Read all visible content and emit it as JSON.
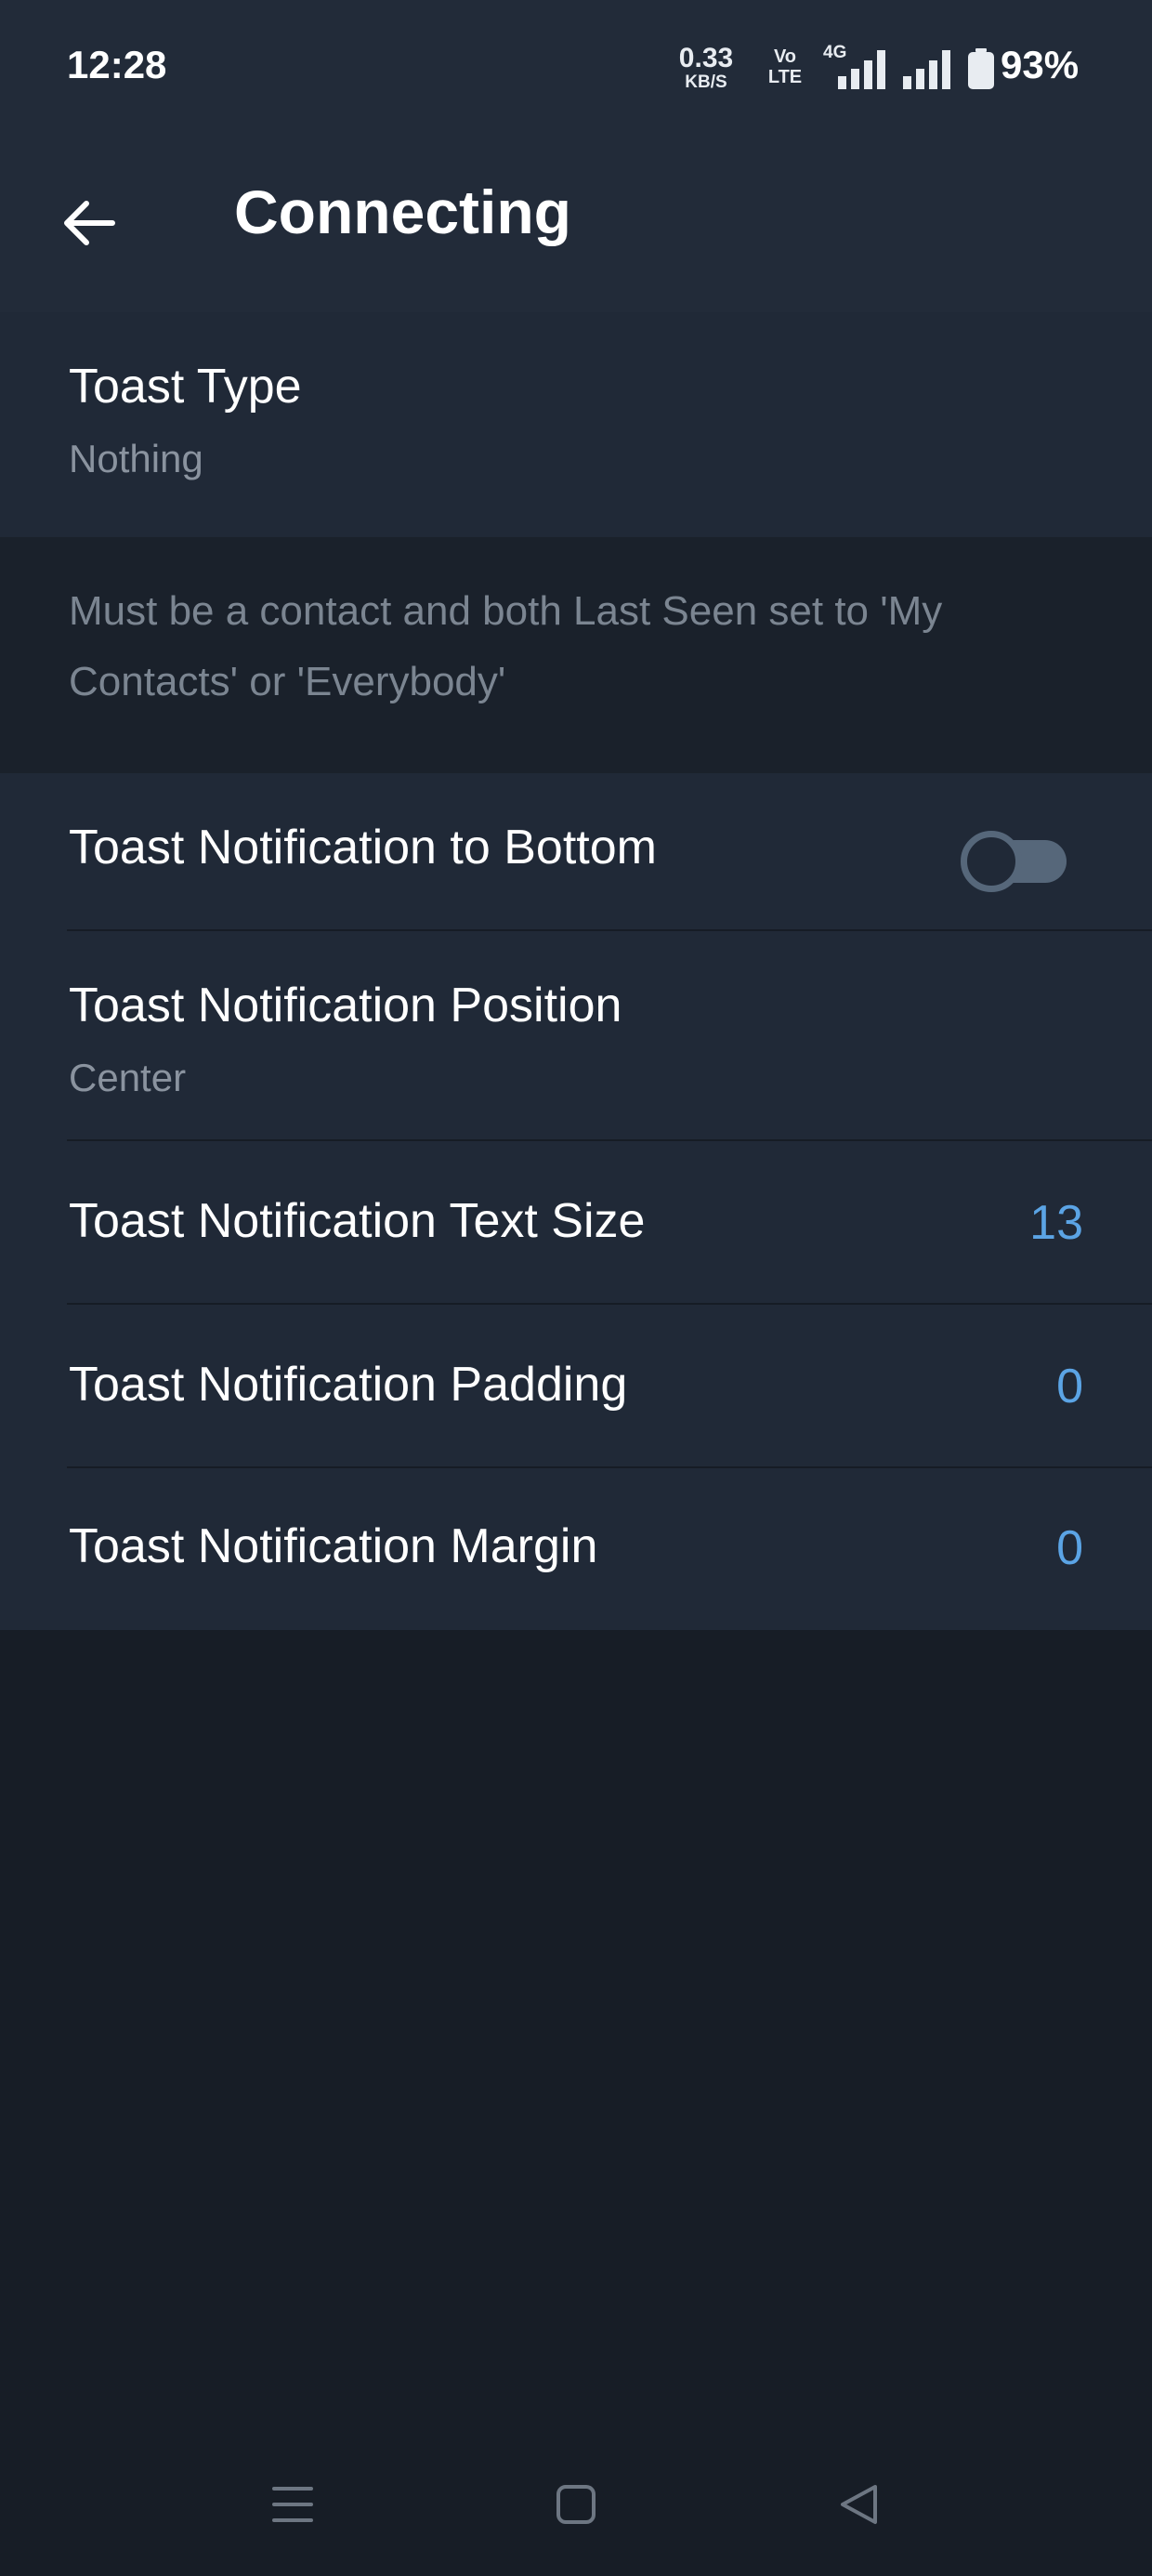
{
  "status_bar": {
    "time": "12:28",
    "net_speed_value": "0.33",
    "net_speed_unit": "KB/S",
    "volte_line1": "Vo",
    "volte_line2": "LTE",
    "network_type": "4G",
    "battery": "93%"
  },
  "header": {
    "title": "Connecting",
    "back_icon": "arrow-left-icon"
  },
  "toast_type": {
    "label": "Toast Type",
    "value": "Nothing"
  },
  "info": {
    "text": "Must be a contact and both Last Seen set to 'My Contacts' or 'Everybody'"
  },
  "settings": {
    "to_bottom": {
      "label": "Toast Notification to Bottom",
      "enabled": false
    },
    "position": {
      "label": "Toast Notification Position",
      "value": "Center"
    },
    "text_size": {
      "label": "Toast Notification Text Size",
      "value": "13"
    },
    "padding": {
      "label": "Toast Notification Padding",
      "value": "0"
    },
    "margin": {
      "label": "Toast Notification Margin",
      "value": "0"
    }
  },
  "nav": {
    "menu_icon": "menu-icon",
    "home_icon": "home-icon",
    "back_icon": "back-triangle-icon"
  },
  "colors": {
    "background": "#171d26",
    "header": "#222b39",
    "section": "#202937",
    "accent": "#5ba4e5"
  }
}
